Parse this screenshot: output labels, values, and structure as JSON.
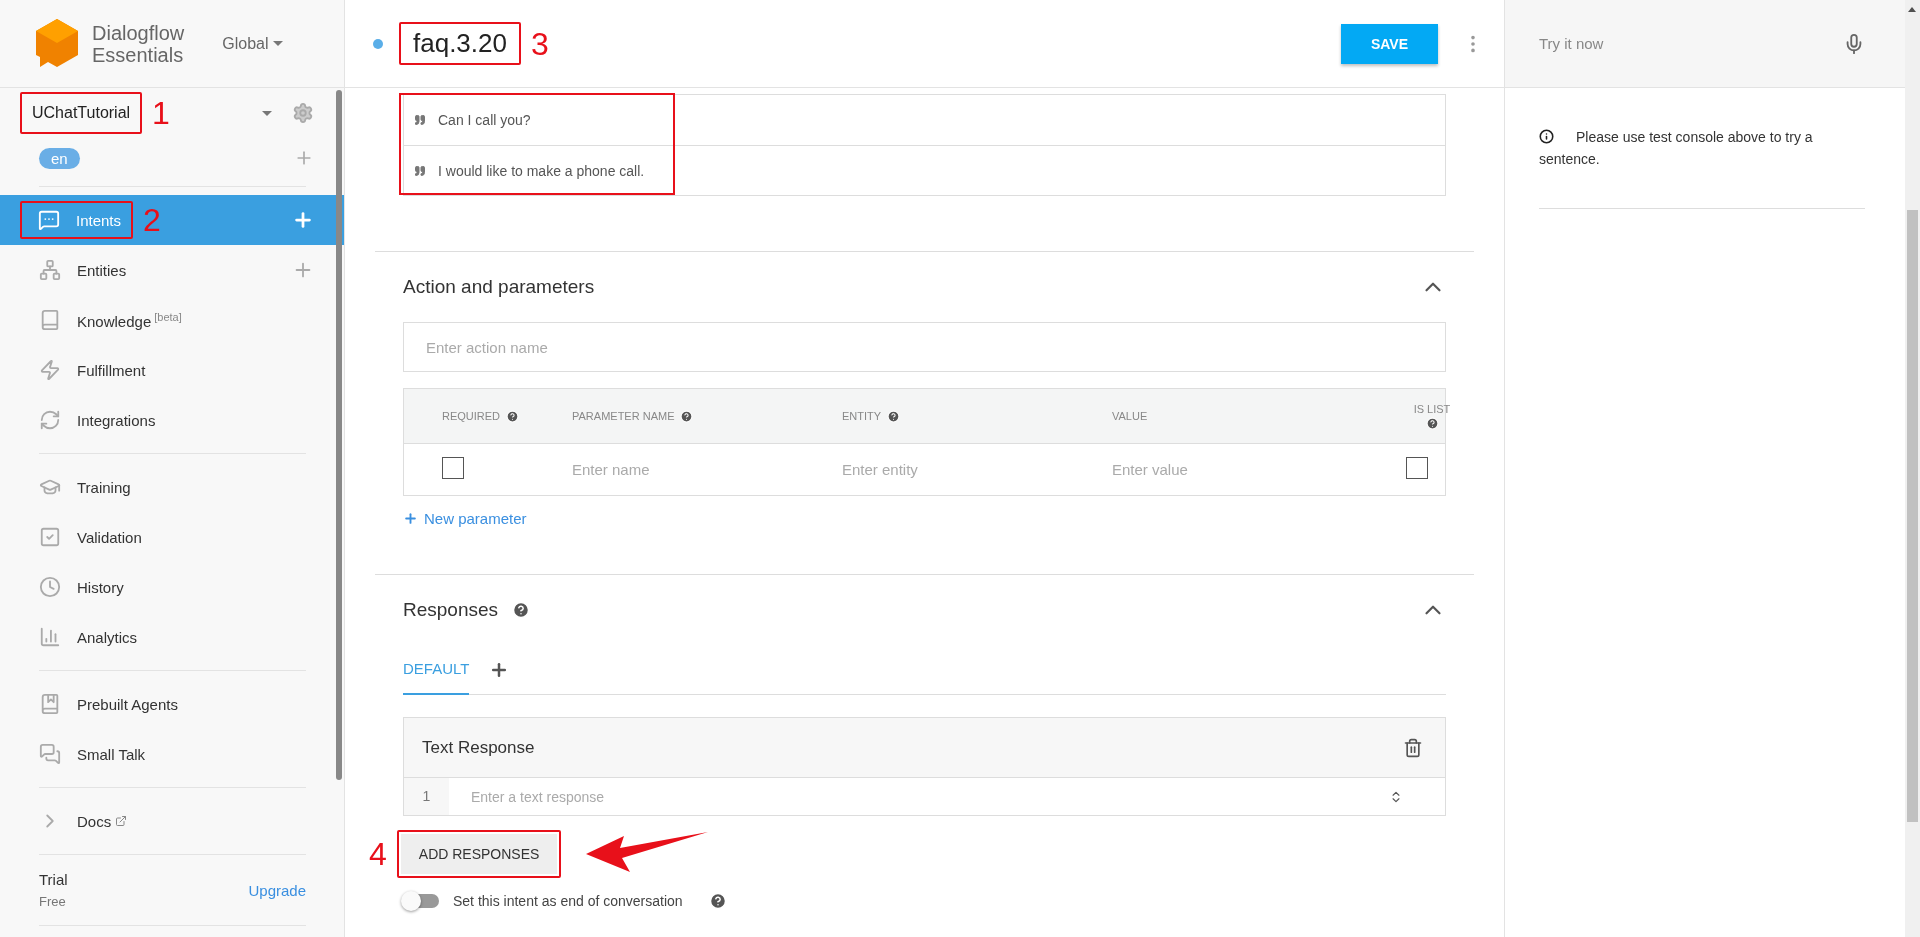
{
  "sidebar": {
    "brand": {
      "line1": "Dialogflow",
      "line2": "Essentials"
    },
    "region": "Global",
    "agent": {
      "name": "UChatTutorial",
      "annotation": "1"
    },
    "language": "en",
    "groups": [
      [
        {
          "label": "Intents",
          "selected": true,
          "add": true,
          "annotation": "2"
        },
        {
          "label": "Entities",
          "selected": false,
          "add": true
        },
        {
          "label": "Knowledge",
          "sup": "[beta]",
          "selected": false,
          "add": false
        },
        {
          "label": "Fulfillment",
          "selected": false,
          "add": false
        },
        {
          "label": "Integrations",
          "selected": false,
          "add": false
        }
      ],
      [
        {
          "label": "Training",
          "selected": false,
          "add": false
        },
        {
          "label": "Validation",
          "selected": false,
          "add": false
        },
        {
          "label": "History",
          "selected": false,
          "add": false
        },
        {
          "label": "Analytics",
          "selected": false,
          "add": false
        }
      ],
      [
        {
          "label": "Prebuilt Agents",
          "selected": false,
          "add": false
        },
        {
          "label": "Small Talk",
          "selected": false,
          "add": false
        }
      ],
      [
        {
          "label": "Docs",
          "selected": false,
          "add": false,
          "external": true
        }
      ]
    ],
    "plan": {
      "name": "Trial",
      "tier": "Free",
      "upgrade": "Upgrade"
    }
  },
  "header": {
    "title": "faq.3.20",
    "annotation": "3",
    "save": "SAVE"
  },
  "training_phrases": {
    "highlighted": true,
    "items": [
      "Can I call you?",
      "I would like to make a phone call."
    ]
  },
  "action": {
    "title": "Action and parameters",
    "placeholder": "Enter action name",
    "columns": [
      {
        "label": "REQUIRED",
        "help": true
      },
      {
        "label": "PARAMETER NAME",
        "help": true
      },
      {
        "label": "ENTITY",
        "help": true
      },
      {
        "label": "VALUE",
        "help": false
      },
      {
        "label": "IS LIST",
        "help": true
      }
    ],
    "row": {
      "required": false,
      "name_placeholder": "Enter name",
      "entity_placeholder": "Enter entity",
      "value_placeholder": "Enter value",
      "is_list": false
    },
    "new_parameter": "New parameter"
  },
  "responses": {
    "title": "Responses",
    "tabs": [
      {
        "label": "DEFAULT",
        "selected": true
      }
    ],
    "card": {
      "title": "Text Response",
      "index": "1",
      "placeholder": "Enter a text response"
    },
    "add": "ADD RESPONSES",
    "add_annotation": "4",
    "end_toggle": {
      "label": "Set this intent as end of conversation",
      "on": false
    }
  },
  "console": {
    "placeholder": "Try it now",
    "info": "Please use test console above to try a sentence."
  }
}
